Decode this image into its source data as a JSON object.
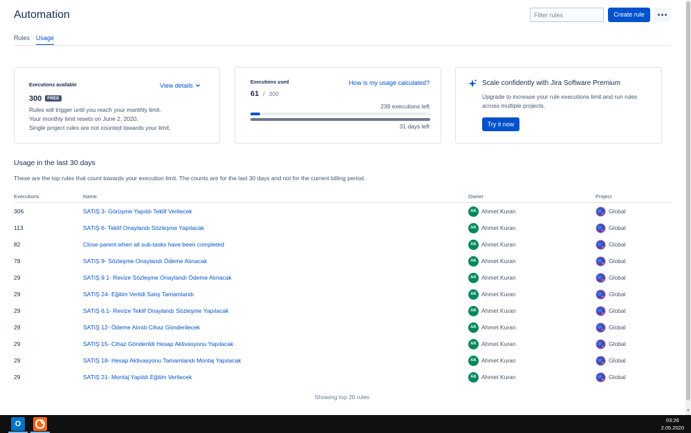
{
  "header": {
    "title": "Automation",
    "filter_placeholder": "Filter rules",
    "create_label": "Create rule",
    "more_icon": "more-horizontal-icon"
  },
  "tabs": [
    {
      "label": "Rules",
      "active": false
    },
    {
      "label": "Usage",
      "active": true
    }
  ],
  "cards": {
    "available": {
      "heading": "Executions available",
      "view_details": "View details",
      "count": "300",
      "badge": "FREE",
      "lines": [
        "Rules will trigger until you reach your monthly limit.",
        "Your monthly limit resets on June 2, 2020.",
        "Single project rules are not counted towards your limit."
      ]
    },
    "used": {
      "heading": "Executions used",
      "calc_link": "How is my usage calculated?",
      "used": "61",
      "separator": "/",
      "total": "300",
      "executions_left": "239 executions left",
      "days_left": "31 days left",
      "executions_fraction": 0.2033,
      "days_fraction": 1.0,
      "accent_color": "#0052cc"
    },
    "premium": {
      "title": "Scale confidently with Jira Software Premium",
      "text_1": "Upgrade to increase your rule executions limit and run rules",
      "text_2": "across multiple projects.",
      "button": "Try it now",
      "icon": "sparkle-icon"
    }
  },
  "usage": {
    "title": "Usage in the last 30 days",
    "description": "These are the top rules that count towards your execution limit. The counts are for the last 30 days and not for the current billing period.",
    "columns": [
      "Executions",
      "Name",
      "Owner",
      "Project"
    ],
    "rows": [
      {
        "executions": "306",
        "name": "SATIŞ 3- Görüşme Yapıldı Teklif Verilecek",
        "owner_initials": "AK",
        "owner": "Ahmet Kuran",
        "project": "Global"
      },
      {
        "executions": "113",
        "name": "SATIŞ 6- Teklif Onaylandı Sözleşme Yapılacak",
        "owner_initials": "AK",
        "owner": "Ahmet Kuran",
        "project": "Global"
      },
      {
        "executions": "82",
        "name": "Close parent when all sub-tasks have been completed",
        "owner_initials": "AK",
        "owner": "Ahmet Kuran",
        "project": "Global"
      },
      {
        "executions": "78",
        "name": "SATIŞ 9- Sözleşme Onaylandı Ödeme Alınacak",
        "owner_initials": "AK",
        "owner": "Ahmet Kuran",
        "project": "Global"
      },
      {
        "executions": "29",
        "name": "SATIŞ 9.1- Revize Sözleşme Onaylandı Ödeme Alınacak",
        "owner_initials": "AK",
        "owner": "Ahmet Kuran",
        "project": "Global"
      },
      {
        "executions": "29",
        "name": "SATIŞ 24- Eğitim Verildi Satış Tamamlandı",
        "owner_initials": "AK",
        "owner": "Ahmet Kuran",
        "project": "Global"
      },
      {
        "executions": "29",
        "name": "SATIŞ 6.1- Revize Teklif Onaylandı Sözleşme Yapılacak",
        "owner_initials": "AK",
        "owner": "Ahmet Kuran",
        "project": "Global"
      },
      {
        "executions": "29",
        "name": "SATIŞ 12- Ödeme Alındı Cihaz Gönderilecek",
        "owner_initials": "AK",
        "owner": "Ahmet Kuran",
        "project": "Global"
      },
      {
        "executions": "29",
        "name": "SATIŞ 15- Cihaz Gönderildi Hesap Aktivasyonu Yapılacak",
        "owner_initials": "AK",
        "owner": "Ahmet Kuran",
        "project": "Global"
      },
      {
        "executions": "29",
        "name": "SATIŞ 18- Hesap Aktivasyonu Tamamlandı Montaj Yapılacak",
        "owner_initials": "AK",
        "owner": "Ahmet Kuran",
        "project": "Global"
      },
      {
        "executions": "29",
        "name": "SATIŞ 21- Montaj Yapıldı Eğitim Verilecek",
        "owner_initials": "AK",
        "owner": "Ahmet Kuran",
        "project": "Global"
      }
    ],
    "footer": "Showing top 20 rules"
  },
  "taskbar": {
    "apps": [
      {
        "name": "outlook-icon",
        "label": "O"
      },
      {
        "name": "browser-app-icon",
        "label": ""
      }
    ],
    "time": "03:26",
    "date": "2.05.2020"
  }
}
